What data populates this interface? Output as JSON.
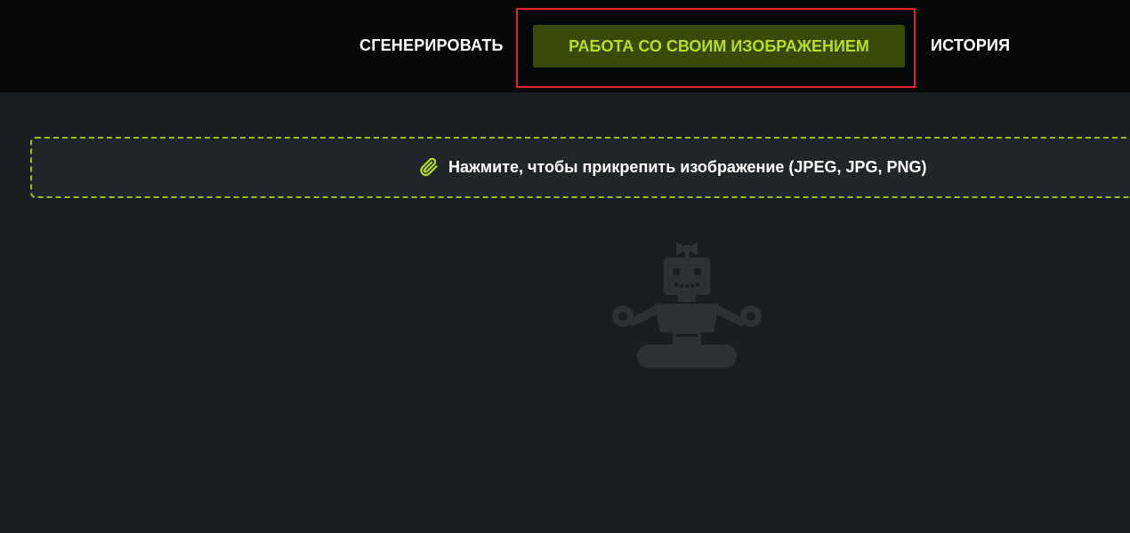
{
  "nav": {
    "generate_label": "СГЕНЕРИРОВАТЬ",
    "own_image_label": "РАБОТА СО СВОИМ ИЗОБРАЖЕНИЕМ",
    "history_label": "ИСТОРИЯ"
  },
  "upload": {
    "label": "Нажмите, чтобы прикрепить изображение (JPEG, JPG, PNG)",
    "icon": "paperclip-icon"
  },
  "empty_state": {
    "icon": "robot-meditating-icon"
  },
  "colors": {
    "accent": "#b5dd2a",
    "active_bg": "#3b4a08",
    "highlight": "#e0242e",
    "background": "#1b1e21",
    "topbar": "#060809"
  }
}
